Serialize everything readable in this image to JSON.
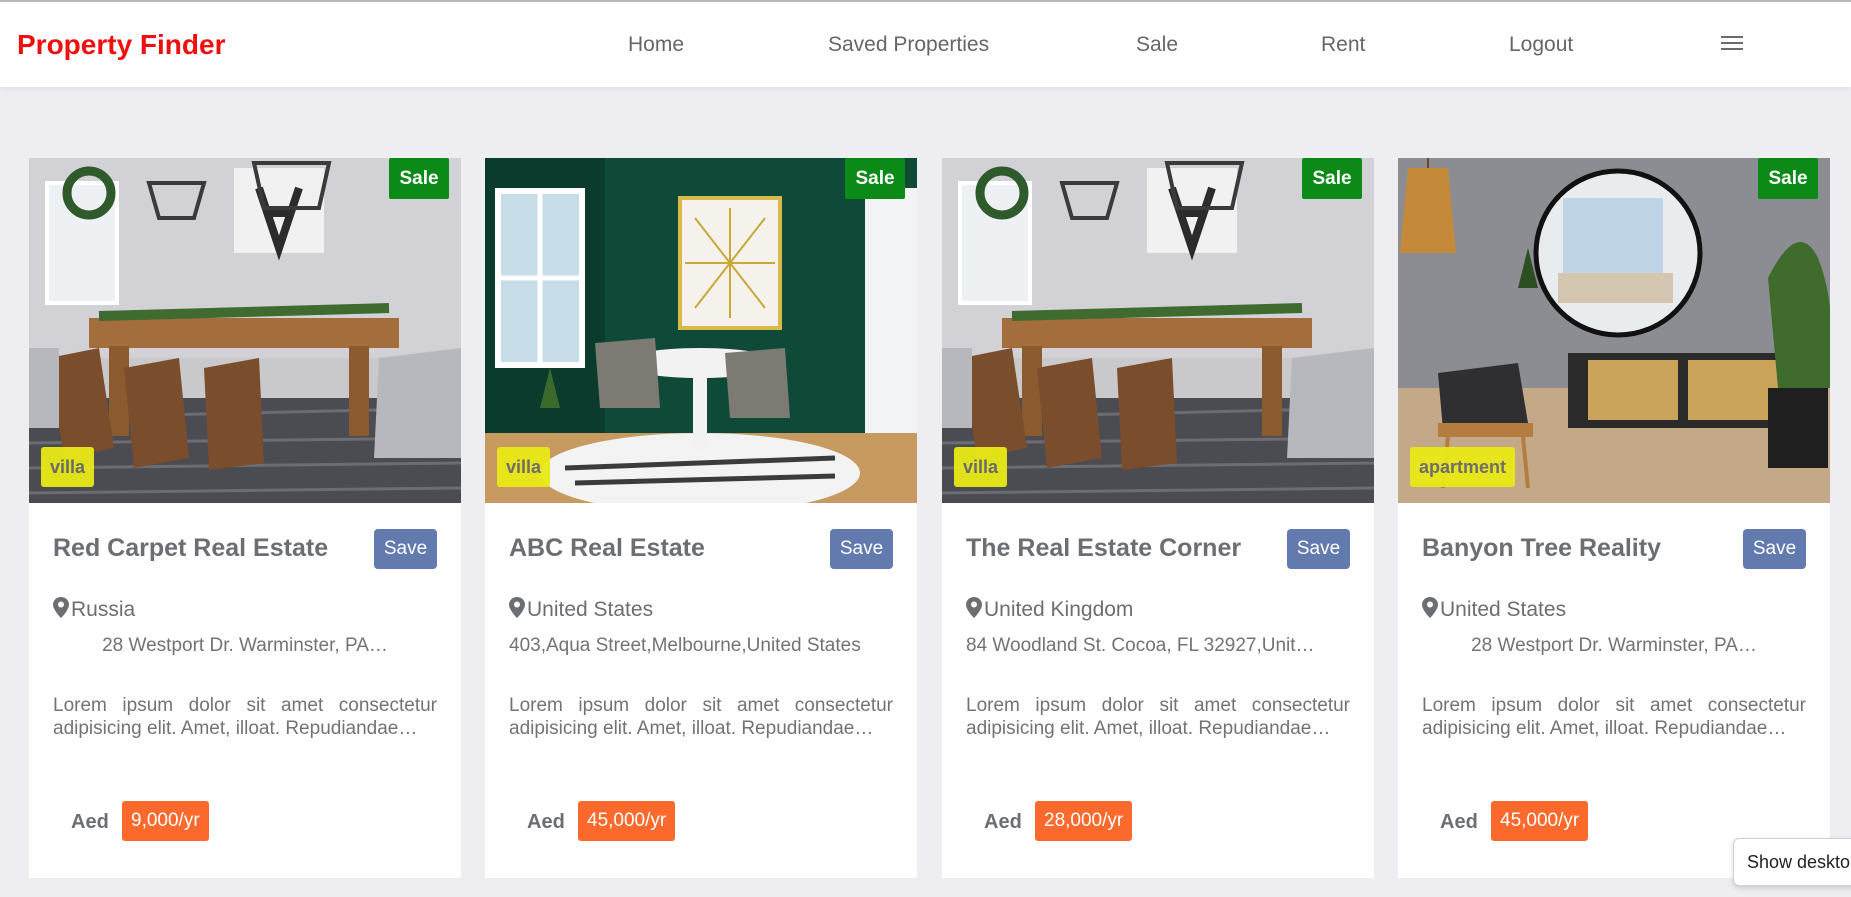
{
  "brand": "Property Finder",
  "nav": {
    "home": "Home",
    "saved": "Saved Properties",
    "sale": "Sale",
    "rent": "Rent",
    "logout": "Logout",
    "menu_icon": "hamburger-menu-icon"
  },
  "cards": [
    {
      "badge": "Sale",
      "type": "villa",
      "title": "Red Carpet Real Estate",
      "save_label": "Save",
      "country": "Russia",
      "address": "28 Westport Dr. Warminster, PA…",
      "description": "Lorem ipsum dolor sit amet consectetur adipisicing elit. Amet, illoat. Repudiandae…",
      "currency": "Aed",
      "price": "9,000/yr",
      "image": "dining-room-photo"
    },
    {
      "badge": "Sale",
      "type": "villa",
      "title": "ABC Real Estate",
      "save_label": "Save",
      "country": "United States",
      "address": "403,Aqua Street,Melbourne,United States",
      "description": "Lorem ipsum dolor sit amet consectetur adipisicing elit. Amet, illoat. Repudiandae…",
      "currency": "Aed",
      "price": "45,000/yr",
      "image": "green-dining-room-photo"
    },
    {
      "badge": "Sale",
      "type": "villa",
      "title": "The Real Estate Corner",
      "save_label": "Save",
      "country": "United Kingdom",
      "address": "84 Woodland St. Cocoa, FL 32927,Unit…",
      "description": "Lorem ipsum dolor sit amet consectetur adipisicing elit. Amet, illoat. Repudiandae…",
      "currency": "Aed",
      "price": "28,000/yr",
      "image": "dining-room-photo"
    },
    {
      "badge": "Sale",
      "type": "apartment",
      "title": "Banyon Tree Reality",
      "save_label": "Save",
      "country": "United States",
      "address": "28 Westport Dr. Warminster, PA…",
      "description": "Lorem ipsum dolor sit amet consectetur adipisicing elit. Amet, illoat. Repudiandae…",
      "currency": "Aed",
      "price": "45,000/yr",
      "image": "living-room-photo"
    }
  ],
  "toast": "Show deskto",
  "colors": {
    "brand": "#ee0f0f",
    "sale_badge": "#0c8a17",
    "type_badge": "#e9ea17",
    "save_button": "#627aad",
    "price_badge": "#fb6a2c",
    "page_background": "#eeedf1"
  }
}
